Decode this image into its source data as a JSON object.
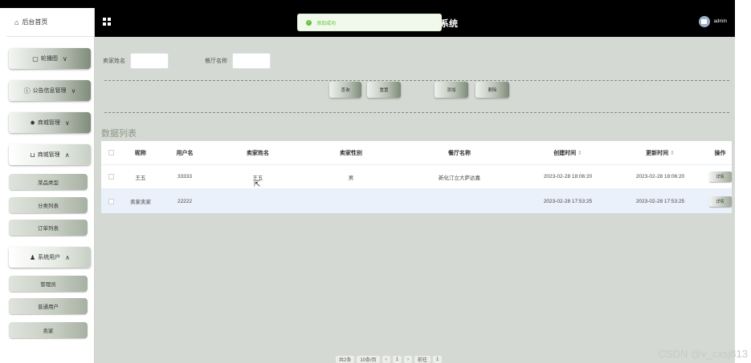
{
  "app": {
    "title_fragment": "系统",
    "toast": "添加成功",
    "user": "admin"
  },
  "sidebar": {
    "home": "后台首页",
    "menus": [
      {
        "label": "轮播图",
        "icon": "image-icon"
      },
      {
        "label": "公告信息管理",
        "icon": "info-circle-icon"
      },
      {
        "label": "商城管理",
        "icon": "gear-icon"
      },
      {
        "label": "商城管理",
        "icon": "cart-icon"
      }
    ],
    "shop_items": [
      "菜品类型",
      "分类列表",
      "订单列表"
    ],
    "users_menu": "系统用户",
    "user_items": [
      "管理员",
      "普通用户",
      "卖家"
    ]
  },
  "search": {
    "seller_name_label": "卖家姓名",
    "restaurant_label": "餐厅名称"
  },
  "buttons": {
    "query": "查询",
    "reset": "重置",
    "add": "添加",
    "delete": "删除"
  },
  "table": {
    "section_title": "数据列表",
    "headers": [
      "昵称",
      "用户名",
      "卖家姓名",
      "卖家性别",
      "餐厅名称",
      "创建时间",
      "更新时间",
      "操作"
    ],
    "sort_mark": "⇕",
    "rows": [
      {
        "nickname": "王五",
        "username": "33333",
        "seller_name": "王五",
        "gender": "男",
        "restaurant": "新化汀立大萨达嘉",
        "created": "2023-02-28 18:06:20",
        "updated": "2023-02-28 18:06:20",
        "action": "详情"
      },
      {
        "nickname": "卖家卖家",
        "username": "22222",
        "seller_name": "",
        "gender": "",
        "restaurant": "",
        "created": "2023-02-28 17:53:25",
        "updated": "2023-02-28 17:53:25",
        "action": "详情"
      }
    ]
  },
  "pager": {
    "total": "共2条",
    "size": "10条/页",
    "page": "1",
    "goto": "前往"
  },
  "watermark": "CSDN @v_cxsj813"
}
